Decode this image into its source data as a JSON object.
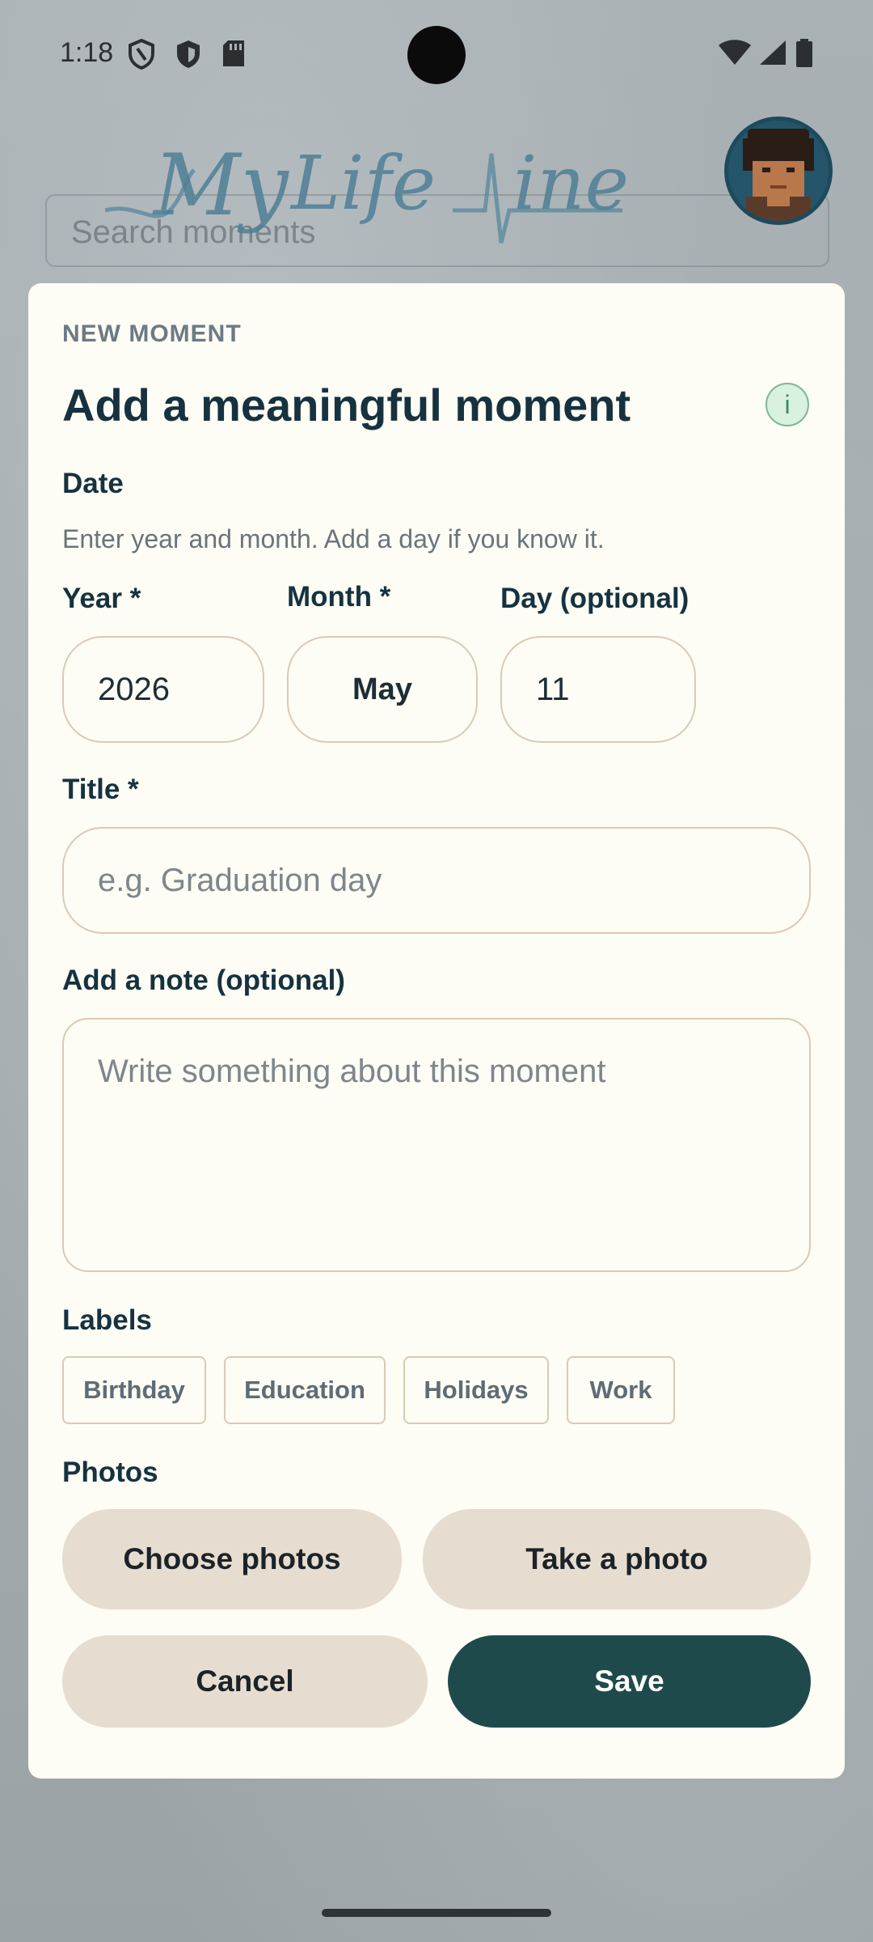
{
  "status_bar": {
    "time": "1:18",
    "icons": [
      "shield-outline-icon",
      "shield-icon",
      "sd-card-icon",
      "wifi-icon",
      "signal-icon",
      "battery-icon"
    ]
  },
  "background": {
    "logo_text": "MyLifeLine",
    "search_placeholder": "Search moments"
  },
  "card": {
    "eyebrow": "NEW MOMENT",
    "title": "Add a meaningful moment",
    "info_icon": "i",
    "date": {
      "label": "Date",
      "hint": "Enter year and month. Add a day if you know it.",
      "year_label": "Year *",
      "year_value": "2026",
      "month_label": "Month *",
      "month_value": "May",
      "day_label": "Day (optional)",
      "day_value": "11"
    },
    "title_field": {
      "label": "Title *",
      "placeholder": "e.g. Graduation day"
    },
    "note_field": {
      "label": "Add a note (optional)",
      "placeholder": "Write something about this moment"
    },
    "labels": {
      "heading": "Labels",
      "items": [
        "Birthday",
        "Education",
        "Holidays",
        "Work"
      ]
    },
    "photos": {
      "heading": "Photos",
      "choose_label": "Choose photos",
      "take_label": "Take a photo"
    },
    "actions": {
      "cancel_label": "Cancel",
      "save_label": "Save"
    }
  },
  "colors": {
    "card_bg": "#fdfcf5",
    "primary": "#1f4a4b",
    "secondary_button": "#e6ddd0",
    "border": "#dcc9b7",
    "heading": "#16323f"
  }
}
